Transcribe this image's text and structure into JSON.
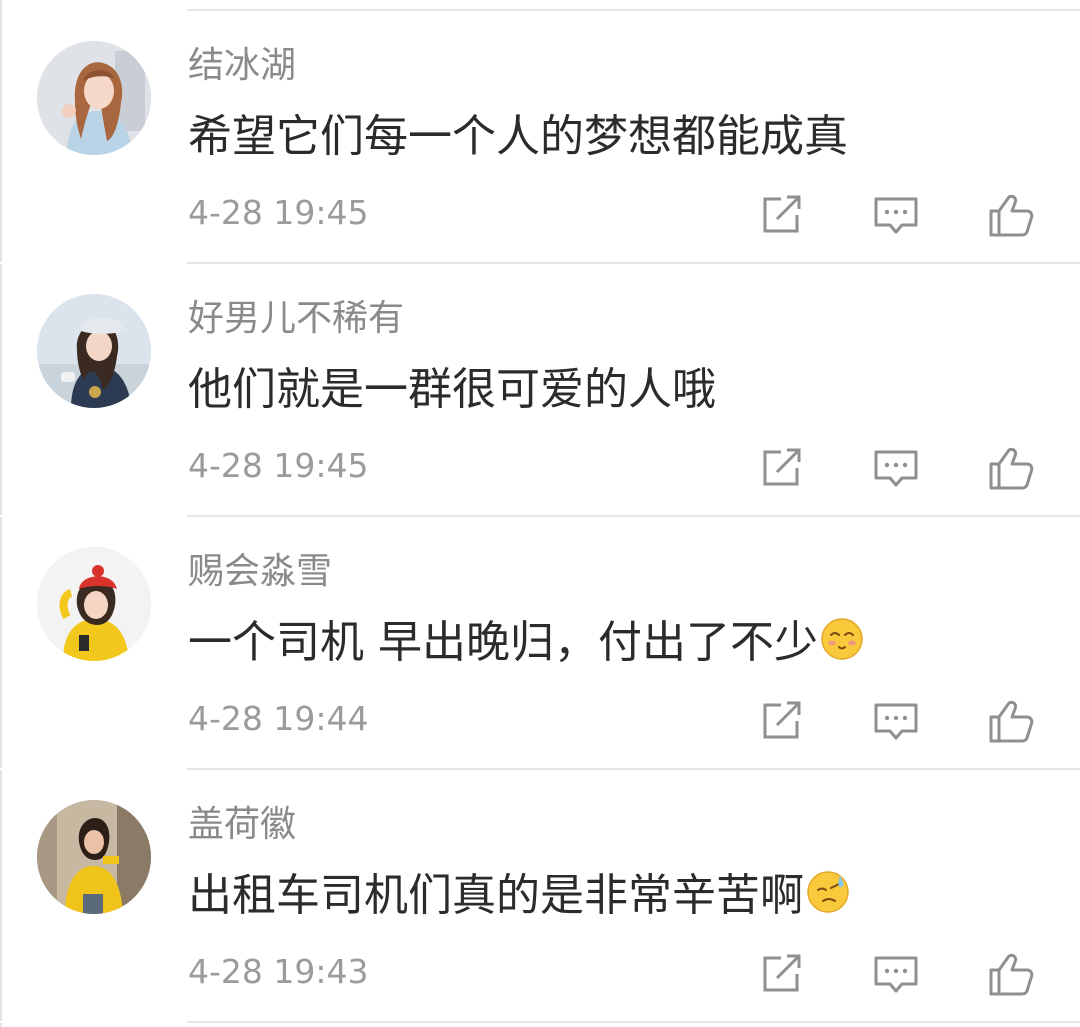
{
  "comments": [
    {
      "username": "结冰湖",
      "text": "希望它们每一个人的梦想都能成真",
      "emoji": "",
      "time": "4-28 19:45",
      "avatar_icon": "avatar-woman-long-hair"
    },
    {
      "username": "好男儿不稀有",
      "text": "他们就是一群很可爱的人哦",
      "emoji": "",
      "time": "4-28 19:45",
      "avatar_icon": "avatar-woman-cap"
    },
    {
      "username": "赐会淼雪",
      "text": "一个司机 早出晚归，付出了不少",
      "emoji": "smiling-blushing-emoji",
      "time": "4-28 19:44",
      "avatar_icon": "avatar-yellow-jacket-red-hat"
    },
    {
      "username": "盖荷徽",
      "text": "出租车司机们真的是非常辛苦啊",
      "emoji": "sweating-emoji",
      "time": "4-28 19:43",
      "avatar_icon": "avatar-yellow-jacket"
    }
  ],
  "actions": {
    "share_icon": "share-icon",
    "reply_icon": "comment-icon",
    "like_icon": "thumbs-up-icon"
  },
  "colors": {
    "username": "#8a8a8a",
    "text": "#2b2b2b",
    "timestamp": "#9b9b9b",
    "divider": "#e6e6e6",
    "icon": "#8f8f8f"
  }
}
